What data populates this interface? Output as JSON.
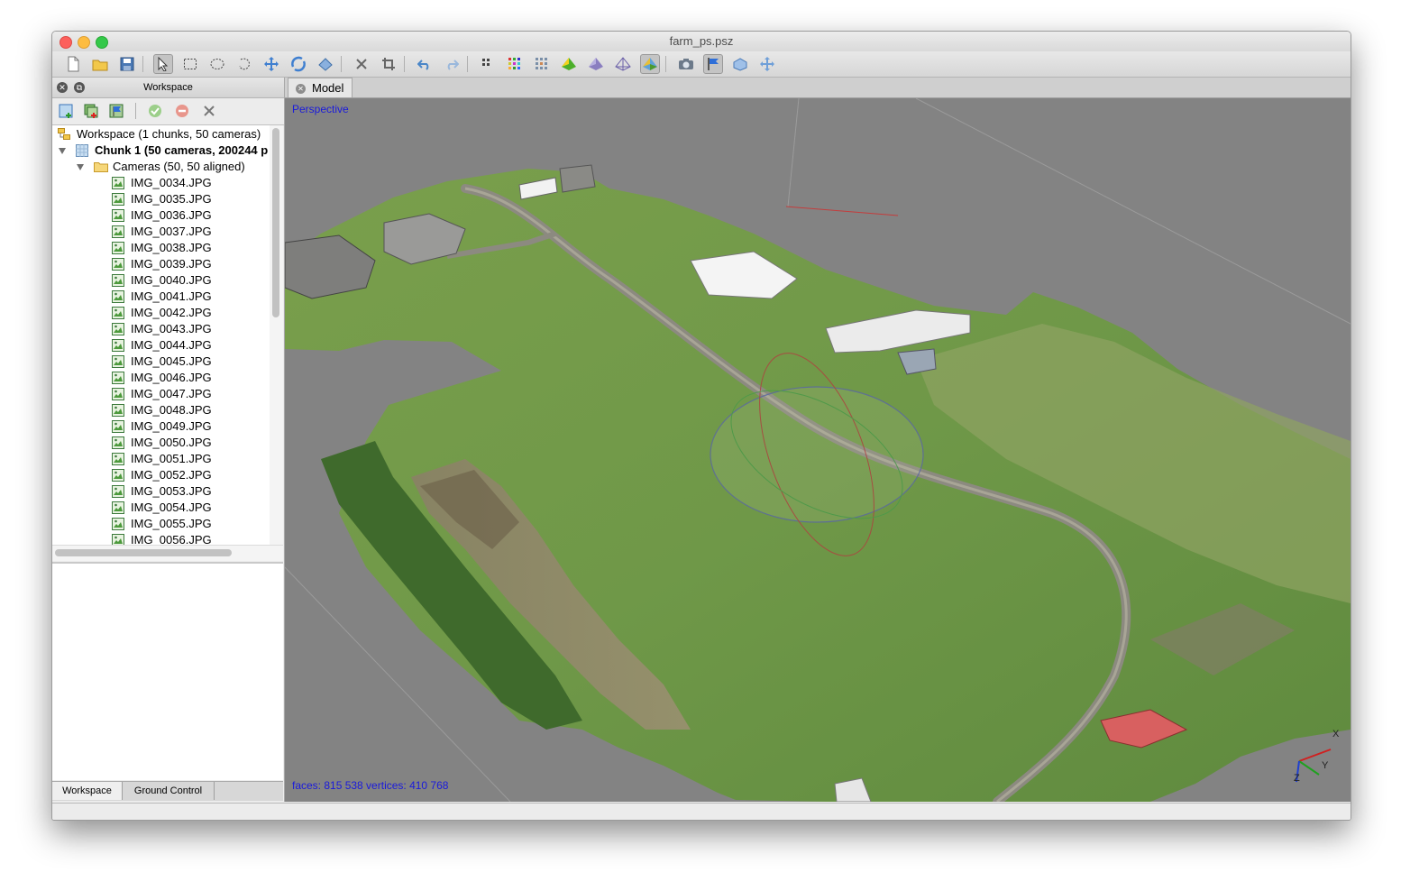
{
  "window": {
    "title": "farm_ps.psz"
  },
  "toolbar": {
    "buttons": [
      {
        "name": "new-document-icon"
      },
      {
        "name": "open-folder-icon"
      },
      {
        "name": "save-icon"
      },
      {
        "name": "navigation-pointer-icon"
      },
      {
        "name": "rectangle-selection-icon"
      },
      {
        "name": "circle-selection-icon"
      },
      {
        "name": "free-form-selection-icon"
      },
      {
        "name": "move-object-icon"
      },
      {
        "name": "rotate-object-icon"
      },
      {
        "name": "resize-region-icon"
      },
      {
        "name": "delete-selection-icon"
      },
      {
        "name": "crop-selection-icon"
      },
      {
        "name": "undo-icon"
      },
      {
        "name": "redo-icon"
      },
      {
        "name": "point-cloud-icon"
      },
      {
        "name": "dense-cloud-icon"
      },
      {
        "name": "dense-cloud-classes-icon"
      },
      {
        "name": "model-shaded-icon"
      },
      {
        "name": "model-solid-icon"
      },
      {
        "name": "model-wireframe-icon"
      },
      {
        "name": "model-textured-icon"
      },
      {
        "name": "show-cameras-icon"
      },
      {
        "name": "show-markers-icon"
      },
      {
        "name": "show-region-icon"
      },
      {
        "name": "reset-view-icon"
      }
    ]
  },
  "workspace_panel": {
    "title": "Workspace",
    "tools": [
      {
        "name": "add-chunk-icon"
      },
      {
        "name": "add-photos-icon"
      },
      {
        "name": "add-markers-icon"
      },
      {
        "name": "enable-cameras-icon"
      },
      {
        "name": "disable-cameras-icon"
      },
      {
        "name": "remove-items-icon"
      }
    ],
    "tree": {
      "root": "Workspace (1 chunks, 50 cameras)",
      "chunk": "Chunk 1 (50 cameras, 200244 p",
      "cameras_folder": "Cameras (50, 50 aligned)",
      "images": [
        "IMG_0034.JPG",
        "IMG_0035.JPG",
        "IMG_0036.JPG",
        "IMG_0037.JPG",
        "IMG_0038.JPG",
        "IMG_0039.JPG",
        "IMG_0040.JPG",
        "IMG_0041.JPG",
        "IMG_0042.JPG",
        "IMG_0043.JPG",
        "IMG_0044.JPG",
        "IMG_0045.JPG",
        "IMG_0046.JPG",
        "IMG_0047.JPG",
        "IMG_0048.JPG",
        "IMG_0049.JPG",
        "IMG_0050.JPG",
        "IMG_0051.JPG",
        "IMG_0052.JPG",
        "IMG_0053.JPG",
        "IMG_0054.JPG",
        "IMG_0055.JPG",
        "IMG_0056.JPG"
      ]
    },
    "bottom_tabs": [
      "Workspace",
      "Ground Control"
    ]
  },
  "model_view": {
    "tab_label": "Model",
    "projection": "Perspective",
    "stats": "faces: 815 538 vertices: 410 768",
    "axes": {
      "x": "X",
      "y": "Y",
      "z": "Z"
    }
  },
  "colors": {
    "overlay_text": "#1a1adc",
    "viewport_bg": "#838383",
    "grass": "#6e9a45",
    "road": "#8c8a80"
  }
}
